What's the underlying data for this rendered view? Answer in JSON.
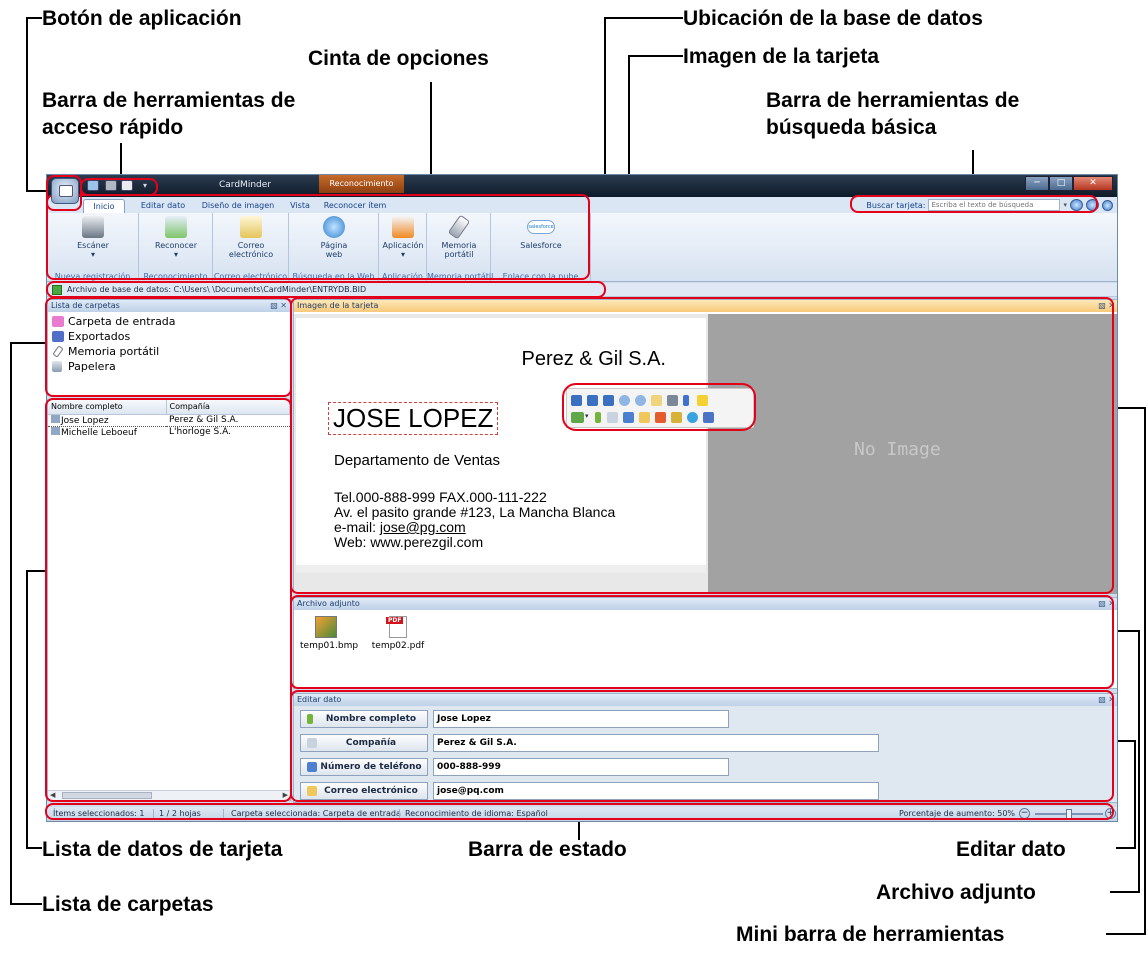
{
  "callouts": {
    "boton_aplicacion": "Botón de aplicación",
    "ubicacion_bd": "Ubicación de la base de datos",
    "cinta_opciones": "Cinta de opciones",
    "imagen_tarjeta": "Imagen de la tarjeta",
    "acceso_rapido_1": "Barra de herramientas de",
    "acceso_rapido_2": "acceso rápido",
    "busqueda_basica_1": "Barra de herramientas de",
    "busqueda_basica_2": "búsqueda básica",
    "lista_datos_tarjeta": "Lista de datos de tarjeta",
    "barra_estado": "Barra de estado",
    "editar_dato": "Editar dato",
    "archivo_adjunto": "Archivo adjunto",
    "lista_carpetas": "Lista de carpetas",
    "mini_barra": "Mini barra de herramientas"
  },
  "window": {
    "title": "CardMinder",
    "context_tab": "Reconocimiento"
  },
  "tabs": [
    "Inicio",
    "Editar dato",
    "Diseño de imagen",
    "Vista",
    "Reconocer ítem"
  ],
  "search": {
    "label": "Buscar tarjeta:",
    "placeholder": "Escriba el texto de búsqueda"
  },
  "ribbon": {
    "buttons": {
      "escaner": "Escáner",
      "reconocer": "Reconocer",
      "correo_1": "Correo",
      "correo_2": "electrónico",
      "pagina_1": "Página",
      "pagina_2": "web",
      "aplicacion": "Aplicación",
      "memoria_1": "Memoria",
      "memoria_2": "portátil",
      "salesforce": "Salesforce",
      "salesforce_logo": "salesforce"
    },
    "groups": [
      "Nueva registración",
      "Reconocimiento",
      "Correo electrónico",
      "Búsqueda en la Web",
      "Aplicación",
      "Memoria portátil",
      "Enlace con la nube"
    ]
  },
  "db_path": "Archivo de base de datos: C:\\Users\\     \\Documents\\CardMinder\\ENTRYDB.BID",
  "folders": {
    "title": "Lista de carpetas",
    "items": [
      "Carpeta de entrada",
      "Exportados",
      "Memoria portátil",
      "Papelera"
    ]
  },
  "card_list": {
    "headers": [
      "Nombre completo",
      "Compañía"
    ],
    "rows": [
      [
        "Jose Lopez",
        "Perez & Gil S.A."
      ],
      [
        "Michelle Leboeuf",
        "L'horloge S.A."
      ]
    ]
  },
  "card_image": {
    "title": "Imagen de la tarjeta",
    "company": "Perez & Gil S.A.",
    "name": "JOSE LOPEZ",
    "department": "Departamento de Ventas",
    "tel": "Tel.000-888-999   FAX.000-111-222",
    "address": "Av. el pasito grande #123, La Mancha Blanca",
    "email_label": "e-mail: ",
    "email": "jose@pg.com",
    "web": "Web: www.perezgil.com",
    "no_image": "No Image"
  },
  "attachments": {
    "title": "Archivo adjunto",
    "files": [
      "temp01.bmp",
      "temp02.pdf"
    ],
    "pdf_badge": "PDF"
  },
  "edit_data": {
    "title": "Editar dato",
    "fields": [
      {
        "label": "Nombre completo",
        "value": "Jose Lopez"
      },
      {
        "label": "Compañía",
        "value": "Perez & Gil S.A."
      },
      {
        "label": "Número de teléfono",
        "value": "000-888-999"
      },
      {
        "label": "Correo electrónico",
        "value": "jose@pq.com"
      }
    ]
  },
  "status": {
    "selected": "Ítems seleccionados:   1",
    "pages": "1 /   2 hojas",
    "folder": "Carpeta seleccionada: Carpeta de entrada",
    "language": "Reconocimiento de idioma: Español",
    "zoom": "Porcentaje de aumento:  50%",
    "zoom_percent": 50
  },
  "colors": {
    "highlight": "#e3001b",
    "ribbon_text": "#15428b",
    "context_tab": "#c76b2a"
  }
}
